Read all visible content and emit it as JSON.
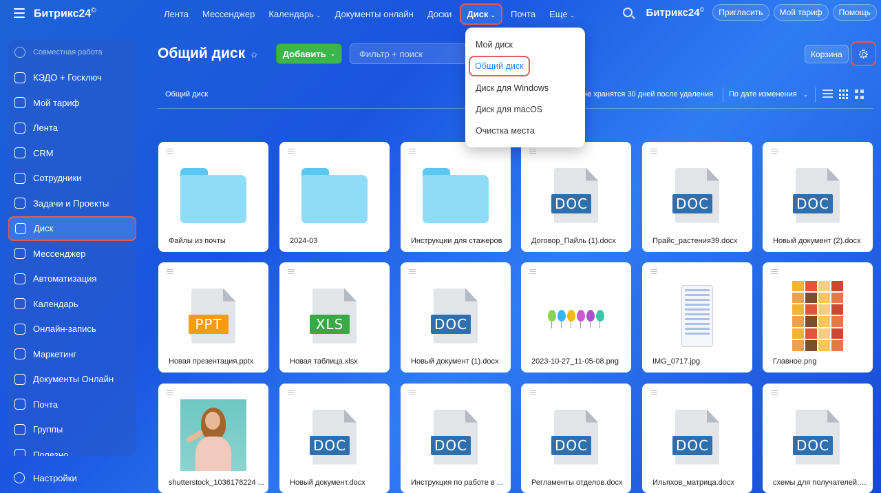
{
  "header": {
    "brand": "Битрикс24",
    "brand_mark": "©",
    "nav": [
      {
        "label": "Лента",
        "chevron": false,
        "active": false
      },
      {
        "label": "Мессенджер",
        "chevron": false,
        "active": false
      },
      {
        "label": "Календарь",
        "chevron": true,
        "active": false
      },
      {
        "label": "Документы онлайн",
        "chevron": false,
        "active": false
      },
      {
        "label": "Доски",
        "chevron": false,
        "active": false
      },
      {
        "label": "Диск",
        "chevron": true,
        "active": true
      },
      {
        "label": "Почта",
        "chevron": false,
        "active": false
      },
      {
        "label": "Еще",
        "chevron": true,
        "active": false
      }
    ],
    "brand_right": "Битрикс24",
    "invite": "Пригласить",
    "my_plan": "Мой тариф",
    "help": "Помощь"
  },
  "sidebar": {
    "items": [
      {
        "label": "Совместная работа",
        "dim": true,
        "active": false
      },
      {
        "label": "КЭДО + Госключ",
        "dim": false,
        "active": false
      },
      {
        "label": "Мой тариф",
        "dim": false,
        "active": false
      },
      {
        "label": "Лента",
        "dim": false,
        "active": false
      },
      {
        "label": "CRM",
        "dim": false,
        "active": false
      },
      {
        "label": "Сотрудники",
        "dim": false,
        "active": false
      },
      {
        "label": "Задачи и Проекты",
        "dim": false,
        "active": false
      },
      {
        "label": "Диск",
        "dim": false,
        "active": true
      },
      {
        "label": "Мессенджер",
        "dim": false,
        "active": false
      },
      {
        "label": "Автоматизация",
        "dim": false,
        "active": false
      },
      {
        "label": "Календарь",
        "dim": false,
        "active": false
      },
      {
        "label": "Онлайн-запись",
        "dim": false,
        "active": false
      },
      {
        "label": "Маркетинг",
        "dim": false,
        "active": false
      },
      {
        "label": "Документы Онлайн",
        "dim": false,
        "active": false
      },
      {
        "label": "Почта",
        "dim": false,
        "active": false
      },
      {
        "label": "Группы",
        "dim": false,
        "active": false
      },
      {
        "label": "Полезно",
        "dim": false,
        "active": false
      }
    ],
    "settings": "Настройки"
  },
  "main": {
    "title": "Общий диск",
    "add_button": "Добавить",
    "filter_placeholder": "Фильтр + поиск",
    "trash": "Корзина",
    "breadcrumb": "Общий диск",
    "notice": "не хранятся 30 дней после удаления",
    "sort": "По дате изменения"
  },
  "dropdown": {
    "items": [
      {
        "label": "Мой диск",
        "active": false
      },
      {
        "label": "Общий диск",
        "active": true
      },
      {
        "label": "Диск для Windows",
        "active": false
      },
      {
        "label": "Диск для macOS",
        "active": false
      },
      {
        "label": "Очистка места",
        "active": false
      }
    ]
  },
  "colors": {
    "doc": "#2f6fae",
    "ppt": "#f39c12",
    "xls": "#3aa845",
    "accent": "#2f7df3",
    "highlight": "#e35a5a",
    "add": "#3cb54a"
  },
  "files": [
    {
      "name": "Файлы из почты",
      "kind": "folder"
    },
    {
      "name": "2024-03",
      "kind": "folder"
    },
    {
      "name": "Инструкции для стажеров",
      "kind": "folder"
    },
    {
      "name": "Договор_Пайль (1).docx",
      "kind": "file",
      "badge": "DOC"
    },
    {
      "name": "Прайс_растения39.docx",
      "kind": "file",
      "badge": "DOC"
    },
    {
      "name": "Новый документ (2).docx",
      "kind": "file",
      "badge": "DOC"
    },
    {
      "name": "Новая презентация.pptx",
      "kind": "file",
      "badge": "PPT"
    },
    {
      "name": "Новая таблица.xlsx",
      "kind": "file",
      "badge": "XLS"
    },
    {
      "name": "Новый документ (1).docx",
      "kind": "file",
      "badge": "DOC"
    },
    {
      "name": "2023-10-27_11-05-08.png",
      "kind": "balloons"
    },
    {
      "name": "IMG_0717.jpg",
      "kind": "phone"
    },
    {
      "name": "Главное.png",
      "kind": "collage"
    },
    {
      "name": "shutterstock_1036178224 ...",
      "kind": "photo"
    },
    {
      "name": "Новый документ.docx",
      "kind": "file",
      "badge": "DOC"
    },
    {
      "name": "Инструкция по работе в ...",
      "kind": "file",
      "badge": "DOC"
    },
    {
      "name": "Регламенты отделов.docx",
      "kind": "file",
      "badge": "DOC"
    },
    {
      "name": "Ильяхов_матрица.docx",
      "kind": "file",
      "badge": "DOC"
    },
    {
      "name": "схемы для получателей.d...",
      "kind": "file",
      "badge": "DOC"
    }
  ]
}
